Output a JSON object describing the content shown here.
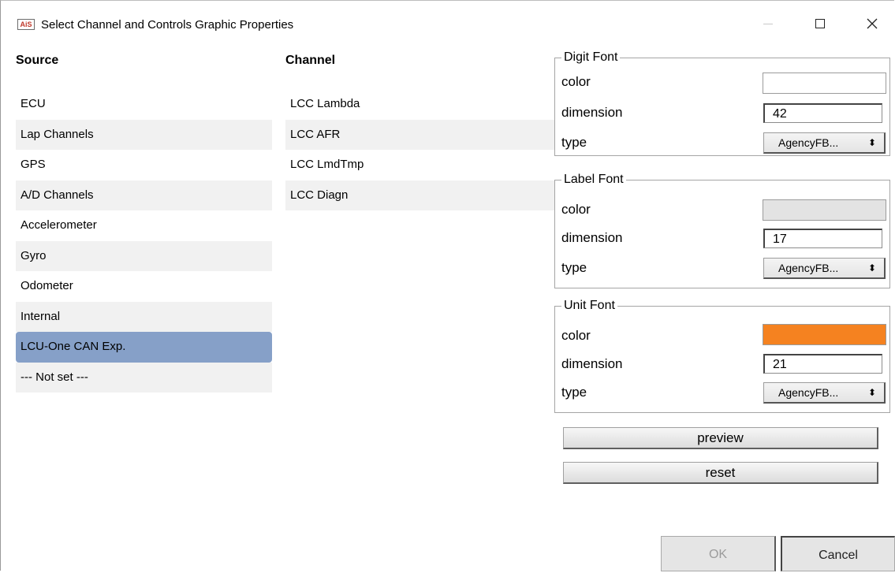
{
  "window": {
    "title": "Select Channel and Controls Graphic Properties",
    "app_icon_text": "AiS",
    "close_glyph": "✕"
  },
  "source": {
    "header": "Source",
    "items": [
      {
        "label": "ECU"
      },
      {
        "label": "Lap Channels"
      },
      {
        "label": "GPS"
      },
      {
        "label": "A/D Channels"
      },
      {
        "label": "Accelerometer"
      },
      {
        "label": "Gyro"
      },
      {
        "label": "Odometer"
      },
      {
        "label": "Internal"
      },
      {
        "label": "LCU-One CAN Exp."
      },
      {
        "label": "--- Not set ---"
      }
    ],
    "selected_index": 8
  },
  "channel": {
    "header": "Channel",
    "items": [
      {
        "label": "LCC Lambda"
      },
      {
        "label": "LCC AFR"
      },
      {
        "label": "LCC LmdTmp"
      },
      {
        "label": "LCC Diagn"
      }
    ]
  },
  "fonts": {
    "digit": {
      "title": "Digit Font",
      "color_label": "color",
      "color_value": "#ffffff",
      "dimension_label": "dimension",
      "dimension_value": "42",
      "type_label": "type",
      "type_value": "AgencyFB..."
    },
    "label": {
      "title": "Label Font",
      "color_label": "color",
      "color_value": "#e3e3e3",
      "dimension_label": "dimension",
      "dimension_value": "17",
      "type_label": "type",
      "type_value": "AgencyFB..."
    },
    "unit": {
      "title": "Unit Font",
      "color_label": "color",
      "color_value": "#f58220",
      "dimension_label": "dimension",
      "dimension_value": "21",
      "type_label": "type",
      "type_value": "AgencyFB..."
    }
  },
  "actions": {
    "preview_label": "preview",
    "reset_label": "reset",
    "ok_label": "OK",
    "cancel_label": "Cancel",
    "ok_enabled": false
  },
  "colors": {
    "selection": "#86a0c8",
    "alt_row": "#f1f1f1"
  }
}
